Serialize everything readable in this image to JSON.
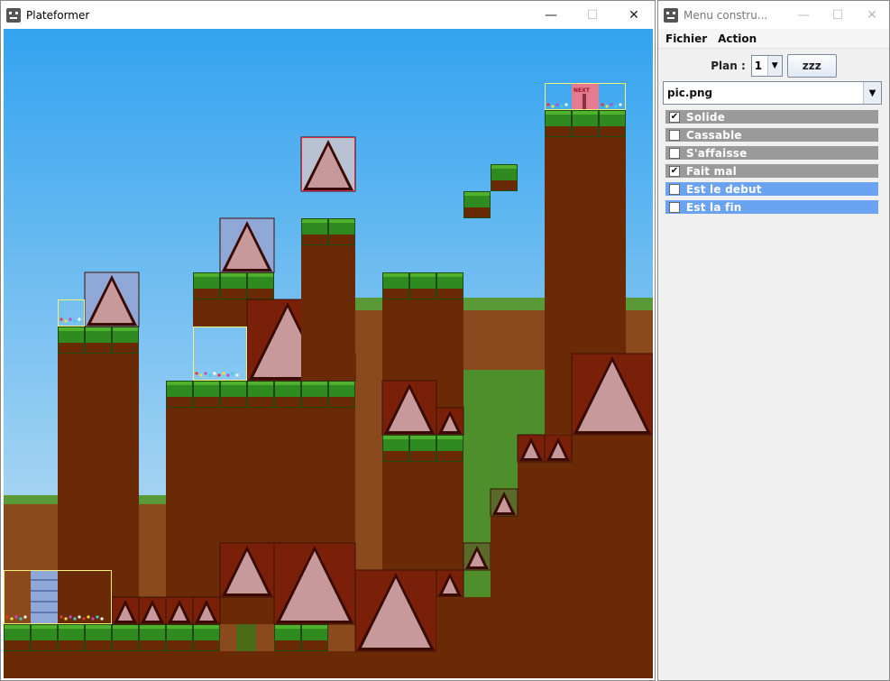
{
  "game_window": {
    "title": "Plateformer",
    "icon": "smiley-app-icon",
    "controls": {
      "minimize": "—",
      "maximize": "☐",
      "close": "✕"
    }
  },
  "tool_window": {
    "title": "Menu constru...",
    "icon": "smiley-app-icon",
    "controls": {
      "minimize": "—",
      "maximize": "☐",
      "close": "✕"
    },
    "menu": {
      "file": "Fichier",
      "action": "Action"
    },
    "plan": {
      "label": "Plan :",
      "value": "1"
    },
    "zzz_button": "zzz",
    "texture_select": {
      "value": "pic.png"
    },
    "properties": [
      {
        "label": "Solide",
        "checked": true,
        "highlight": false
      },
      {
        "label": "Cassable",
        "checked": false,
        "highlight": false
      },
      {
        "label": "S'affaisse",
        "checked": false,
        "highlight": false
      },
      {
        "label": "Fait mal",
        "checked": true,
        "highlight": false
      },
      {
        "label": "Est le debut",
        "checked": false,
        "highlight": true
      },
      {
        "label": "Est la fin",
        "checked": false,
        "highlight": true
      }
    ]
  },
  "game": {
    "end_sign_text": "NEXT",
    "colors": {
      "sky_top": "#33a3f0",
      "sky_bottom": "#cfe6f3",
      "grass": "#2f8a1f",
      "grass_light": "#4fb22c",
      "dirt": "#6a2a05",
      "dirt_red": "#7a2008",
      "spike": "#c7999b",
      "spike_edge": "#3a0a05",
      "block_blue": "#8fa8d8",
      "highlight_yellow": "#f5f07a"
    }
  }
}
